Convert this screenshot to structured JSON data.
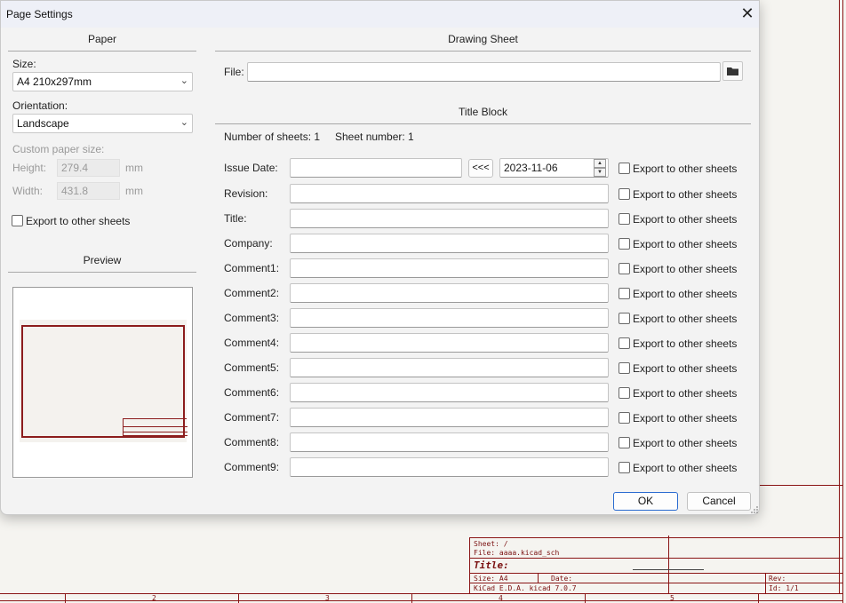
{
  "dialog": {
    "title": "Page Settings",
    "close_icon": "close-icon"
  },
  "paper": {
    "heading": "Paper",
    "size_label": "Size:",
    "size_value": "A4 210x297mm",
    "orientation_label": "Orientation:",
    "orientation_value": "Landscape",
    "custom_size_label": "Custom paper size:",
    "height_label": "Height:",
    "height_value": "279.4",
    "height_unit": "mm",
    "width_label": "Width:",
    "width_value": "431.8",
    "width_unit": "mm",
    "export_label": "Export to other sheets",
    "preview_heading": "Preview"
  },
  "drawing_sheet": {
    "heading": "Drawing Sheet",
    "file_label": "File:",
    "file_value": "",
    "folder_icon": "folder-icon"
  },
  "title_block": {
    "heading": "Title Block",
    "num_sheets": "Number of sheets: 1",
    "sheet_number": "Sheet number: 1",
    "issue_date_label": "Issue Date:",
    "issue_date_value": "",
    "copy_date_button": "<<<",
    "date_picker_value": "2023-11-06",
    "export_label": "Export to other sheets",
    "rows": [
      {
        "label": "Revision:",
        "value": ""
      },
      {
        "label": "Title:",
        "value": ""
      },
      {
        "label": "Company:",
        "value": ""
      },
      {
        "label": "Comment1:",
        "value": ""
      },
      {
        "label": "Comment2:",
        "value": ""
      },
      {
        "label": "Comment3:",
        "value": ""
      },
      {
        "label": "Comment4:",
        "value": ""
      },
      {
        "label": "Comment5:",
        "value": ""
      },
      {
        "label": "Comment6:",
        "value": ""
      },
      {
        "label": "Comment7:",
        "value": ""
      },
      {
        "label": "Comment8:",
        "value": ""
      },
      {
        "label": "Comment9:",
        "value": ""
      }
    ]
  },
  "buttons": {
    "ok": "OK",
    "cancel": "Cancel"
  },
  "background_sheet": {
    "sheet_line": "Sheet: /",
    "file_line": "File: aaaa.kicad_sch",
    "title_line": "Title:",
    "size_line": "Size: A4",
    "date_line": "Date:",
    "rev_line": "Rev:",
    "kicad_line": "KiCad E.D.A.  kicad 7.0.7",
    "id_line": "Id: 1/1",
    "col_numbers": [
      "2",
      "3",
      "4",
      "5"
    ]
  },
  "colors": {
    "schematic_border": "#8a1515",
    "accent": "#2a6bd0"
  }
}
